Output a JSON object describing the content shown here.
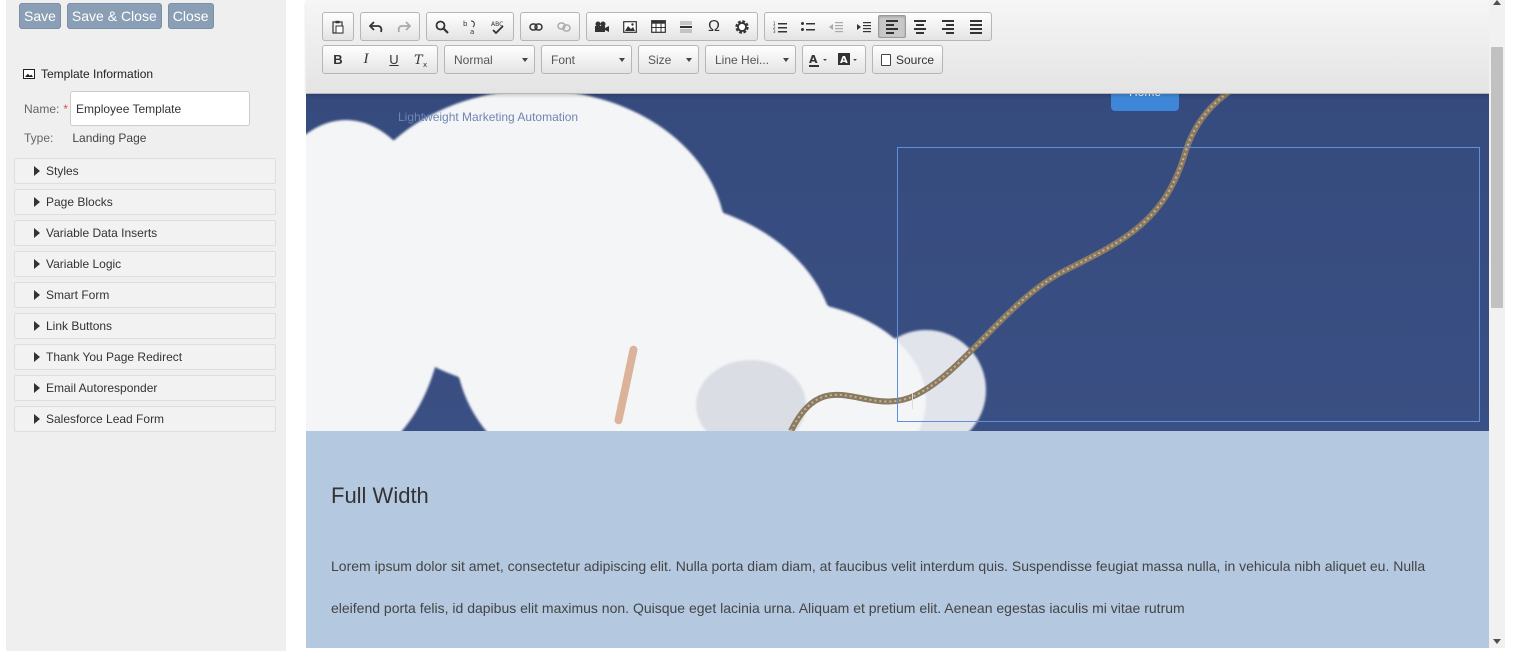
{
  "actions": {
    "save": "Save",
    "save_close": "Save & Close",
    "close": "Close"
  },
  "template_info": {
    "heading": "Template Information",
    "name_label": "Name:",
    "required_mark": "*",
    "name_value": "Employee Template",
    "type_label": "Type:",
    "type_value": "Landing Page"
  },
  "sections": [
    "Styles",
    "Page Blocks",
    "Variable Data Inserts",
    "Variable Logic",
    "Smart Form",
    "Link Buttons",
    "Thank You Page Redirect",
    "Email Autoresponder",
    "Salesforce Lead Form"
  ],
  "toolbar": {
    "format": "Normal",
    "font": "Font",
    "size": "Size",
    "line_height": "Line Hei...",
    "source": "Source",
    "bold": "B",
    "italic": "I",
    "underline": "U",
    "omega": "Ω"
  },
  "hero": {
    "logo_tagline": "Lightweight Marketing Automation",
    "nav_home": "Home"
  },
  "content": {
    "heading": "Full Width",
    "body": "Lorem ipsum dolor sit amet, consectetur adipiscing elit. Nulla porta diam diam, at faucibus velit interdum quis. Suspendisse feugiat massa nulla, in vehicula nibh aliquet eu. Nulla eleifend porta felis, id dapibus elit maximus non. Quisque eget lacinia urna. Aliquam et pretium elit. Aenean egestas iaculis mi vitae rutrum"
  },
  "colors": {
    "button_bg": "#8a9fb6",
    "hero_bg": "#3a4f83",
    "content_bg": "#b4c9e0",
    "selection_border": "#5e8fd8",
    "nav_active": "#3e87d8"
  }
}
